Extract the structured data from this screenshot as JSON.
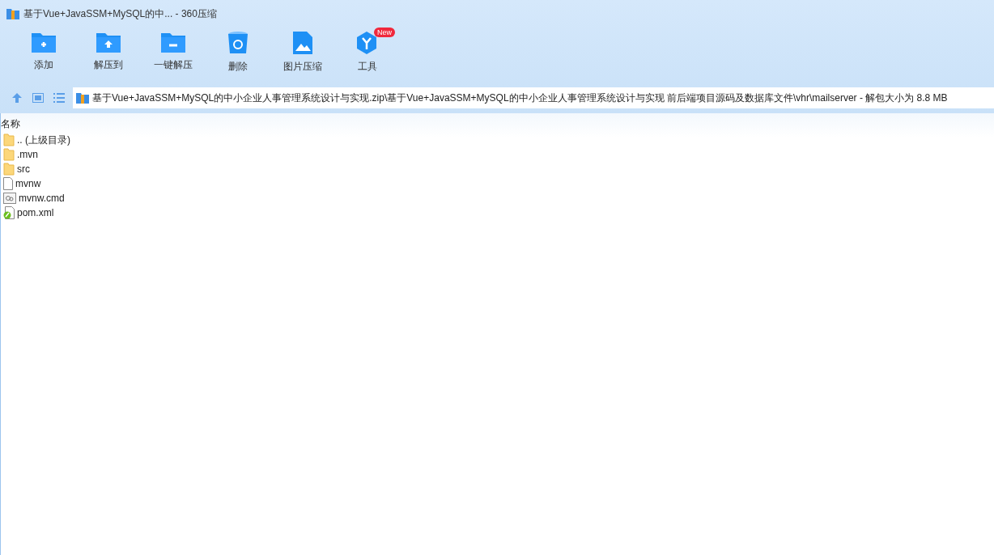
{
  "window": {
    "title": "基于Vue+JavaSSM+MySQL的中... - 360压缩"
  },
  "toolbar": [
    {
      "kind": "add",
      "label": "添加"
    },
    {
      "kind": "extract",
      "label": "解压到"
    },
    {
      "kind": "oneclick",
      "label": "一键解压"
    },
    {
      "kind": "delete",
      "label": "删除"
    },
    {
      "kind": "image",
      "label": "图片压缩"
    },
    {
      "kind": "tools",
      "label": "工具",
      "badge": "New"
    }
  ],
  "address": {
    "path": "基于Vue+JavaSSM+MySQL的中小企业人事管理系统设计与实现.zip\\基于Vue+JavaSSM+MySQL的中小企业人事管理系统设计与实现 前后端项目源码及数据库文件\\vhr\\mailserver - 解包大小为 8.8 MB"
  },
  "table": {
    "columns": [
      "名称"
    ],
    "rows": [
      {
        "kind": "folder",
        "name": ".. (上级目录)"
      },
      {
        "kind": "folder",
        "name": ".mvn"
      },
      {
        "kind": "folder",
        "name": "src"
      },
      {
        "kind": "file",
        "name": "mvnw"
      },
      {
        "kind": "cmd",
        "name": "mvnw.cmd"
      },
      {
        "kind": "xml",
        "name": "pom.xml"
      }
    ]
  }
}
